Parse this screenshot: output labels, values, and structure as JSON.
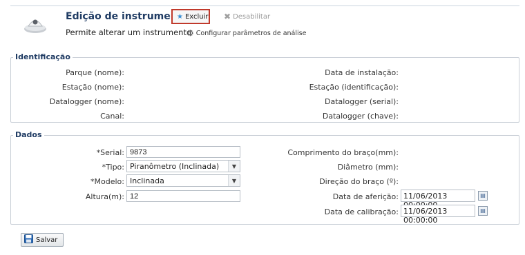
{
  "header": {
    "title": "Edição de instrumento",
    "subtitle": "Permite alterar um instrumento",
    "excluir_label": "Excluir",
    "desabilitar_label": "Desabilitar",
    "configurar_label": "Configurar parâmetros de análise"
  },
  "identificacao": {
    "legend": "Identificação",
    "left_labels": [
      "Parque (nome):",
      "Estação (nome):",
      "Datalogger (nome):",
      "Canal:"
    ],
    "right_labels": [
      "Data de instalação:",
      "Estação (identificação):",
      "Datalogger (serial):",
      "Datalogger (chave):"
    ]
  },
  "dados": {
    "legend": "Dados",
    "serial_label": "*Serial:",
    "serial_value": "9873",
    "tipo_label": "*Tipo:",
    "tipo_value": "Piranômetro (Inclinada)",
    "modelo_label": "*Modelo:",
    "modelo_value": "Inclinada",
    "altura_label": "Altura(m):",
    "altura_value": "12",
    "comprimento_label": "Comprimento do braço(mm):",
    "diametro_label": "Diâmetro (mm):",
    "direcao_label": "Direção do braço (º):",
    "afericao_label": "Data de aferição:",
    "afericao_value": "11/06/2013 00:00:00",
    "calibracao_label": "Data de calibração:",
    "calibracao_value": "11/06/2013 00:00:00"
  },
  "footer": {
    "salvar_label": "Salvar"
  },
  "colors": {
    "title": "#1f3b63",
    "highlight_border": "#c0392b",
    "border": "#c8ced6"
  }
}
